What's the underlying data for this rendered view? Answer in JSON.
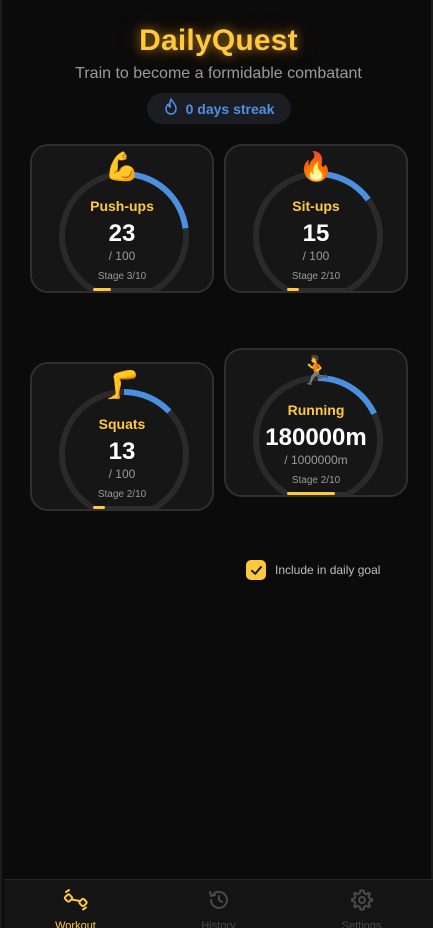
{
  "app": {
    "title": "DailyQuest",
    "subtitle": "Train to become a formidable combatant"
  },
  "streak": {
    "label": "0 days streak",
    "icon": "flame-outline-icon"
  },
  "exercises": [
    {
      "name": "Push-ups",
      "emoji": "💪",
      "count": "23",
      "target": "/ 100",
      "stage": "Stage 3/10",
      "ring_progress": 0.23,
      "stage_progress": 0.3
    },
    {
      "name": "Sit-ups",
      "emoji": "🔥",
      "count": "15",
      "target": "/ 100",
      "stage": "Stage 2/10",
      "ring_progress": 0.15,
      "stage_progress": 0.2
    },
    {
      "name": "Squats",
      "emoji": "🦵",
      "count": "13",
      "target": "/ 100",
      "stage": "Stage 2/10",
      "ring_progress": 0.13,
      "stage_progress": 0.2
    },
    {
      "name": "Running",
      "emoji": "🏃",
      "count": "180000m",
      "target": "/ 1000000m",
      "stage": "Stage 2/10",
      "ring_progress": 0.18,
      "stage_progress": 0.8
    }
  ],
  "daily_goal": {
    "label": "Include in daily goal",
    "checked": true
  },
  "nav": {
    "items": [
      {
        "label": "Workout",
        "icon": "dumbbell-icon",
        "active": true
      },
      {
        "label": "History",
        "icon": "history-icon",
        "active": false
      },
      {
        "label": "Settings",
        "icon": "gear-icon",
        "active": false
      }
    ]
  },
  "colors": {
    "accent": "#ffc83d",
    "ring": "#4a8fe0",
    "ring_track": "#2a2a2a",
    "background": "#0b0b0b",
    "card": "#161616"
  }
}
